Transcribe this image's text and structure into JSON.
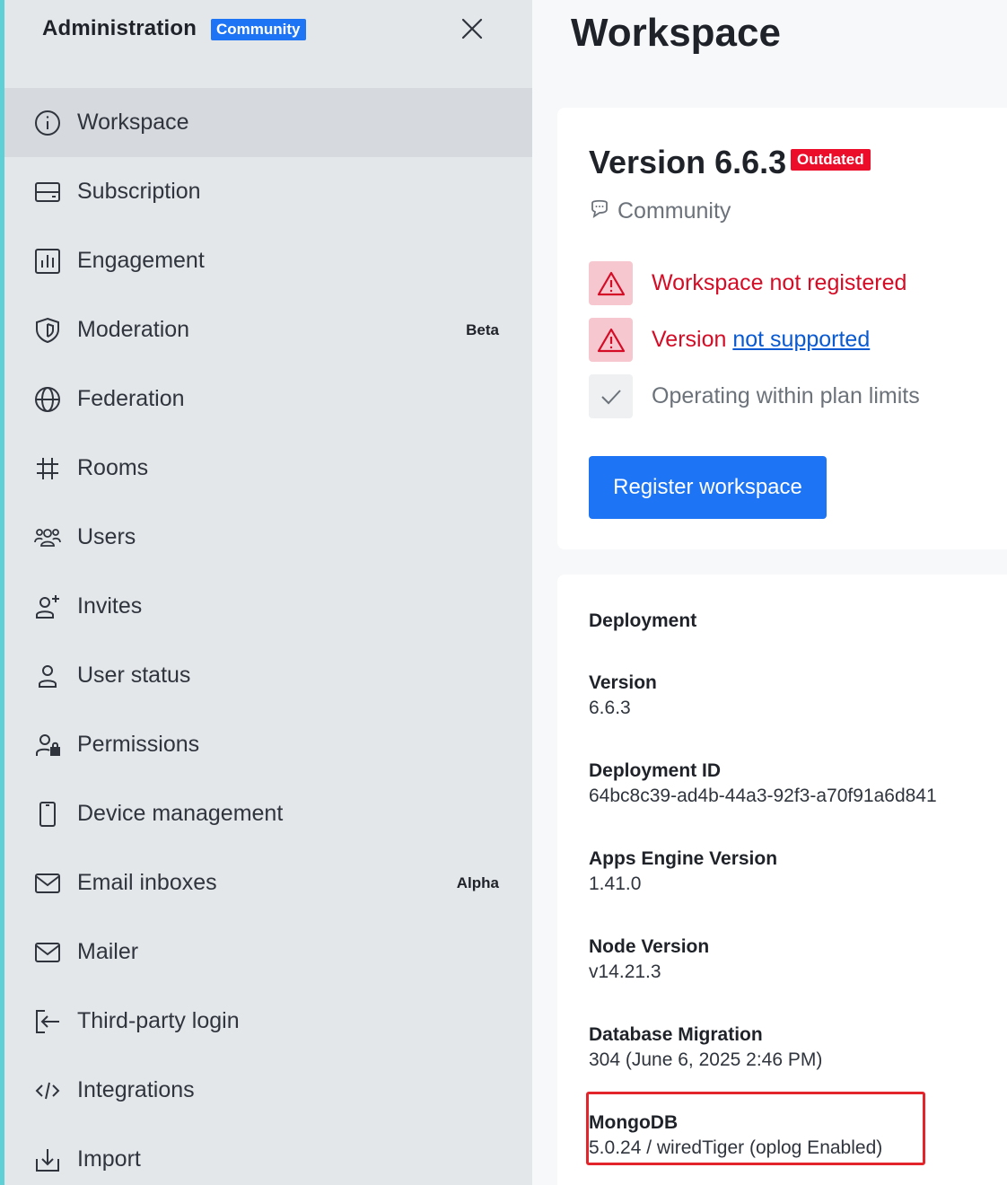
{
  "sidebar": {
    "title": "Administration",
    "badge": "Community",
    "close_icon": "close-icon",
    "items": [
      {
        "label": "Workspace",
        "icon": "info-icon",
        "tag": "",
        "active": true
      },
      {
        "label": "Subscription",
        "icon": "card-icon",
        "tag": ""
      },
      {
        "label": "Engagement",
        "icon": "bar-chart-icon",
        "tag": ""
      },
      {
        "label": "Moderation",
        "icon": "shield-icon",
        "tag": "Beta"
      },
      {
        "label": "Federation",
        "icon": "globe-icon",
        "tag": ""
      },
      {
        "label": "Rooms",
        "icon": "hashtag-icon",
        "tag": ""
      },
      {
        "label": "Users",
        "icon": "team-icon",
        "tag": ""
      },
      {
        "label": "Invites",
        "icon": "user-plus-icon",
        "tag": ""
      },
      {
        "label": "User status",
        "icon": "user-icon",
        "tag": ""
      },
      {
        "label": "Permissions",
        "icon": "user-lock-icon",
        "tag": ""
      },
      {
        "label": "Device management",
        "icon": "mobile-icon",
        "tag": ""
      },
      {
        "label": "Email inboxes",
        "icon": "mail-icon",
        "tag": "Alpha"
      },
      {
        "label": "Mailer",
        "icon": "mail-icon",
        "tag": ""
      },
      {
        "label": "Third-party login",
        "icon": "login-icon",
        "tag": ""
      },
      {
        "label": "Integrations",
        "icon": "code-icon",
        "tag": ""
      },
      {
        "label": "Import",
        "icon": "import-icon",
        "tag": ""
      }
    ]
  },
  "main": {
    "title": "Workspace",
    "version_card": {
      "version": "Version 6.6.3",
      "status_badge": "Outdated",
      "edition": "Community",
      "checks": [
        {
          "status": "error",
          "icon": "warning-icon",
          "text": "Workspace not registered"
        },
        {
          "status": "error",
          "icon": "warning-icon",
          "text": "Version ",
          "link": "not supported"
        },
        {
          "status": "ok",
          "icon": "check-icon",
          "text": "Operating within plan limits"
        }
      ],
      "register_button": "Register workspace"
    },
    "deployment_card": {
      "heading": "Deployment",
      "fields": [
        {
          "label": "Version",
          "value": "6.6.3"
        },
        {
          "label": "Deployment ID",
          "value": "64bc8c39-ad4b-44a3-92f3-a70f91a6d841"
        },
        {
          "label": "Apps Engine Version",
          "value": "1.41.0"
        },
        {
          "label": "Node Version",
          "value": "v14.21.3"
        },
        {
          "label": "Database Migration",
          "value": "304 (June 6, 2025 2:46 PM)"
        },
        {
          "label": "MongoDB",
          "value": "5.0.24 / wiredTiger (oplog Enabled)"
        }
      ]
    }
  },
  "colors": {
    "accent": "#1d74f5",
    "danger": "#ec0d2a",
    "sidebar_edge": "#5ed0d6",
    "highlight": "#e3242b"
  }
}
